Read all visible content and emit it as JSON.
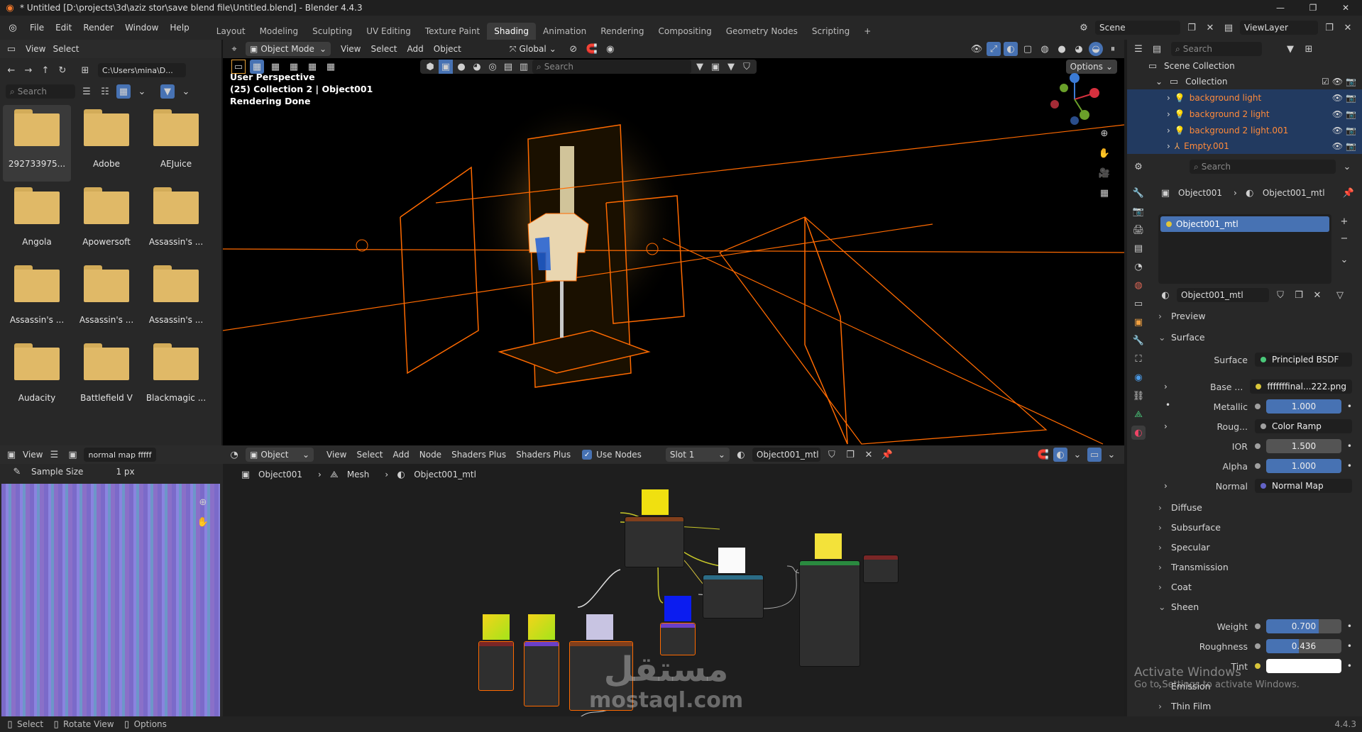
{
  "titlebar": {
    "title": "* Untitled [D:\\projects\\3d\\aziz stor\\save blend file\\Untitled.blend] - Blender 4.4.3",
    "min": "—",
    "max": "❐",
    "close": "✕"
  },
  "menu": {
    "items": [
      "File",
      "Edit",
      "Render",
      "Window",
      "Help"
    ]
  },
  "workspaces": {
    "tabs": [
      "Layout",
      "Modeling",
      "Sculpting",
      "UV Editing",
      "Texture Paint",
      "Shading",
      "Animation",
      "Rendering",
      "Compositing",
      "Geometry Nodes",
      "Scripting"
    ],
    "active": "Shading",
    "add": "+"
  },
  "scene": {
    "scene_label": "Scene",
    "viewlayer_label": "ViewLayer"
  },
  "filebrowser": {
    "menu": [
      "View",
      "Select"
    ],
    "path": "C:\\Users\\mina\\D...",
    "search_placeholder": "Search",
    "folders": [
      "292733975...",
      "Adobe",
      "AEJuice",
      "Angola",
      "Apowersoft",
      "Assassin's ...",
      "Assassin's ...",
      "Assassin's ...",
      "Assassin's ...",
      "Audacity",
      "Battlefield V",
      "Blackmagic ..."
    ]
  },
  "viewport": {
    "mode": "Object Mode",
    "menu": [
      "View",
      "Select",
      "Add",
      "Object"
    ],
    "orientation": "Global",
    "search_placeholder": "Search",
    "options": "Options",
    "overlay_line1": "User Perspective",
    "overlay_line2": "(25) Collection 2 | Object001",
    "overlay_line3": "Rendering Done"
  },
  "imageeditor": {
    "view": "View",
    "image_name": "normal map fffff",
    "sample_label": "Sample Size",
    "sample_value": "1 px"
  },
  "nodeeditor": {
    "type": "Object",
    "menu": [
      "View",
      "Select",
      "Add",
      "Node",
      "Shaders Plus",
      "Shaders Plus"
    ],
    "use_nodes": "Use Nodes",
    "slot": "Slot 1",
    "material": "Object001_mtl",
    "breadcrumb": [
      "Object001",
      "Mesh",
      "Object001_mtl"
    ]
  },
  "outliner": {
    "search_placeholder": "Search",
    "scene_collection": "Scene Collection",
    "collection": "Collection",
    "items": [
      "background light",
      "background 2 light",
      "background 2 light.001",
      "Empty.001"
    ]
  },
  "properties": {
    "search_placeholder": "Search",
    "breadcrumb_obj": "Object001",
    "breadcrumb_mat": "Object001_mtl",
    "slot_item": "Object001_mtl",
    "material_field": "Object001_mtl",
    "sections": {
      "preview": "Preview",
      "surface": "Surface",
      "diffuse": "Diffuse",
      "subsurface": "Subsurface",
      "specular": "Specular",
      "transmission": "Transmission",
      "coat": "Coat",
      "sheen": "Sheen",
      "emission": "Emission",
      "thin_film": "Thin Film"
    },
    "rows": {
      "surface": {
        "label": "Surface",
        "value": "Principled BSDF"
      },
      "base": {
        "label": "Base ...",
        "value": "fffffffinal...222.png"
      },
      "metallic": {
        "label": "Metallic",
        "value": "1.000",
        "fraction": 1.0
      },
      "roughness": {
        "label": "Roug...",
        "value": "Color Ramp"
      },
      "ior": {
        "label": "IOR",
        "value": "1.500"
      },
      "alpha": {
        "label": "Alpha",
        "value": "1.000",
        "fraction": 1.0
      },
      "normal": {
        "label": "Normal",
        "value": "Normal Map"
      },
      "sheen_weight": {
        "label": "Weight",
        "value": "0.700",
        "fraction": 0.7
      },
      "sheen_rough": {
        "label": "Roughness",
        "value": "0.436",
        "fraction": 0.436
      },
      "tint": {
        "label": "Tint",
        "value": ""
      }
    }
  },
  "watermark": {
    "activate1": "Activate Windows",
    "activate2": "Go to Settings to activate Windows.",
    "logo1": "مستقل",
    "logo2": "mostaql.com"
  },
  "statusbar": {
    "select": "Select",
    "rotate": "Rotate View",
    "options": "Options",
    "version": "4.4.3"
  },
  "colors": {
    "accent": "#4772b3",
    "selection_orange": "#ff6a00",
    "folder": "#e0b967"
  }
}
